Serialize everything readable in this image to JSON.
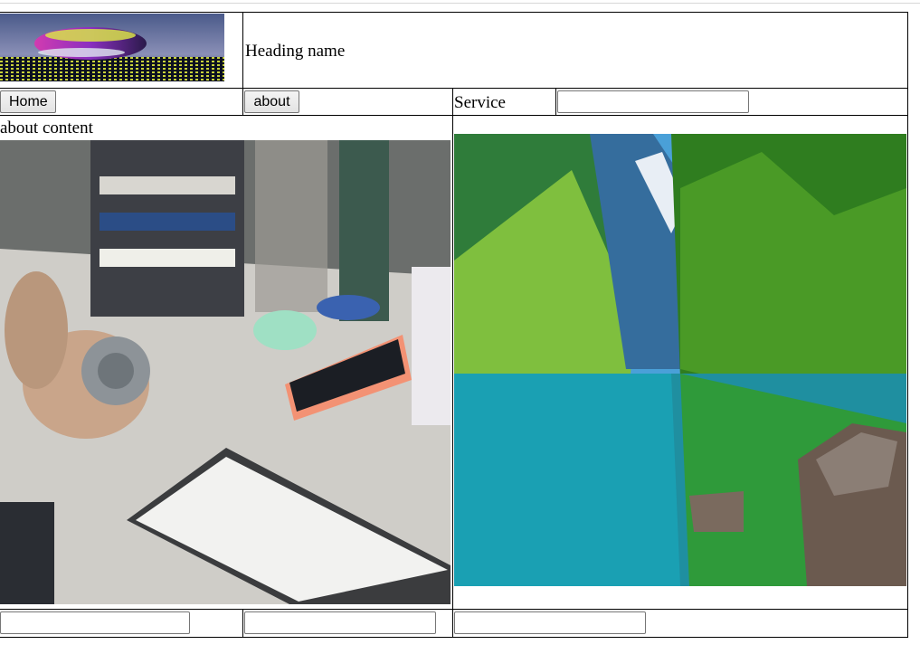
{
  "header": {
    "title": "Heading name",
    "logo_icon": "abstract-disc-logo-icon"
  },
  "nav": {
    "home_label": "Home",
    "about_label": "about",
    "service_label": "Service",
    "service_input_value": ""
  },
  "content": {
    "about_heading": "about content",
    "left_image_icon": "desk-headphones-keyboard-photo",
    "right_image_icon": "mountain-lake-forest-photo"
  },
  "footer": {
    "input1_value": "",
    "input2_value": "",
    "input3_value": ""
  },
  "colors": {
    "border": "#000000",
    "button_bg": "#efefef",
    "input_border": "#767676"
  }
}
